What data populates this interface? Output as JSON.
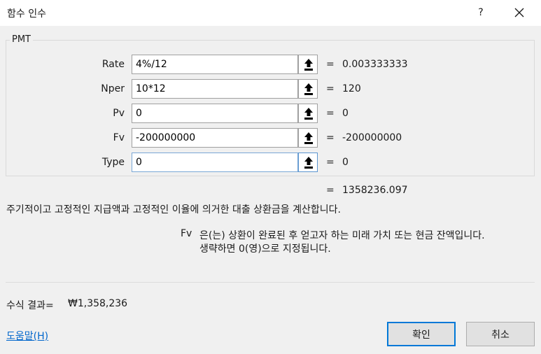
{
  "window": {
    "title": "함수 인수",
    "help_label": "?"
  },
  "function": {
    "name": "PMT"
  },
  "arguments": [
    {
      "label": "Rate",
      "input": "4%/12",
      "equals": "=",
      "value": "0.003333333"
    },
    {
      "label": "Nper",
      "input": "10*12",
      "equals": "=",
      "value": "120"
    },
    {
      "label": "Pv",
      "input": "0",
      "equals": "=",
      "value": "0"
    },
    {
      "label": "Fv",
      "input": "-200000000",
      "equals": "=",
      "value": "-200000000"
    },
    {
      "label": "Type",
      "input": "0",
      "equals": "=",
      "value": "0"
    }
  ],
  "result": {
    "equals": "=",
    "value": "1358236.097"
  },
  "description": "주기적이고 고정적인 지급액과 고정적인 이율에 의거한 대출 상환금을 계산합니다.",
  "arg_help": {
    "name": "Fv",
    "line1": "은(는) 상환이 완료된 후 얻고자 하는 미래 가치 또는 현금 잔액입니다.",
    "line2": "생략하면 0(영)으로 지정됩니다."
  },
  "formula_result": {
    "label": "수식 결과=",
    "value": "₩1,358,236"
  },
  "footer": {
    "help_link": "도움말(H)",
    "ok_label": "확인",
    "cancel_label": "취소"
  },
  "icons": {
    "close": "close-icon",
    "collapse": "range-select-icon"
  },
  "colors": {
    "accent": "#0078d7",
    "link": "#0066cc"
  }
}
